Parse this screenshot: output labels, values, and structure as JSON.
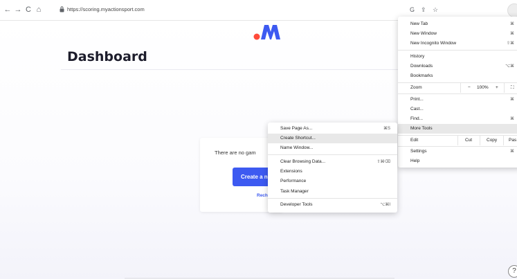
{
  "browser": {
    "url": "https://scoring.myactionsport.com",
    "nav_back": "←",
    "nav_forward": "→",
    "nav_reload": "C",
    "nav_home": "⌂",
    "toolbar_icons": [
      "G",
      "⇪",
      "☆"
    ]
  },
  "page": {
    "title": "Dashboard",
    "empty_text": "There are no gam",
    "create_button": "Create a n",
    "recheck_link": "Rech",
    "help_icon": "?",
    "accent": "#3d5af1",
    "logo_dot": "#ff4b3a"
  },
  "chrome_menu": {
    "new_tab": "New Tab",
    "new_tab_sc": "⌘",
    "new_window": "New Window",
    "new_window_sc": "⌘",
    "new_incognito": "New Incognito Window",
    "new_incognito_sc": "⇧⌘",
    "history": "History",
    "downloads": "Downloads",
    "downloads_sc": "⌥⌘",
    "bookmarks": "Bookmarks",
    "zoom": "Zoom",
    "zoom_minus": "−",
    "zoom_value": "100%",
    "zoom_plus": "+",
    "zoom_fullscreen": "⛶",
    "print": "Print...",
    "print_sc": "⌘",
    "cast": "Cast...",
    "find": "Find...",
    "find_sc": "⌘",
    "more_tools": "More Tools",
    "edit": "Edit",
    "cut": "Cut",
    "copy": "Copy",
    "paste": "Pas",
    "settings": "Settings",
    "settings_sc": "⌘",
    "help": "Help"
  },
  "more_tools_menu": {
    "save_page": "Save Page As...",
    "save_page_sc": "⌘S",
    "create_shortcut": "Create Shortcut...",
    "name_window": "Name Window...",
    "clear_data": "Clear Browsing Data...",
    "clear_data_sc": "⇧⌘⌫",
    "extensions": "Extensions",
    "performance": "Performance",
    "task_manager": "Task Manager",
    "dev_tools": "Developer Tools",
    "dev_tools_sc": "⌥⌘I"
  }
}
